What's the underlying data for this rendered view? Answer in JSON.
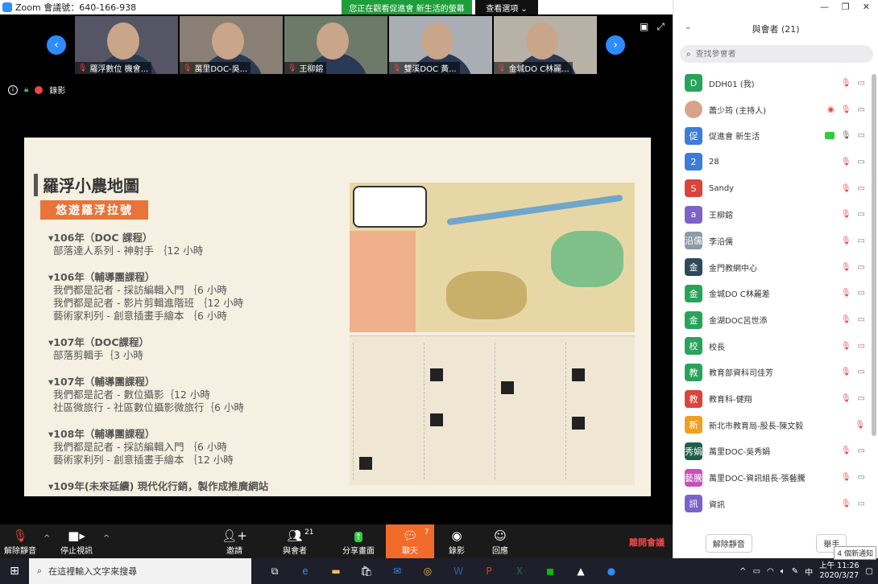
{
  "window": {
    "title": "Zoom 會議號：640-166-938",
    "banner": "您正在觀看促進會 新生活的螢幕",
    "view_options": "查看選項 ⌄"
  },
  "status": {
    "recording_label": "錄影"
  },
  "thumbnails": [
    {
      "name": "羅浮數位 機會..."
    },
    {
      "name": "萬里DOC-吳..."
    },
    {
      "name": "王柳鎔"
    },
    {
      "name": "雙溪DOC   黃..."
    },
    {
      "name": "金城DO C林麗..."
    }
  ],
  "slide": {
    "title": "羅浮小農地圖",
    "subtitle": "悠遊羅浮拉號",
    "groups": [
      {
        "heading": "▾106年（DOC 課程）",
        "items": [
          "部落達人系列 - 神射手 ｛12 小時"
        ]
      },
      {
        "heading": "▾106年（輔導團課程）",
        "items": [
          "我們都是記者 - 採訪編輯入門 ｛6 小時",
          "我們都是記者 - 影片剪輯進階班 ｛12 小時",
          "藝術家利列 - 創意插畫手繪本 ｛6 小時"
        ]
      },
      {
        "heading": "▾107年（DOC課程）",
        "items": [
          "部落剪輯手｛3 小時"
        ]
      },
      {
        "heading": "▾107年（輔導團課程）",
        "items": [
          "我們都是記者 - 數位攝影｛12 小時",
          "社區微旅行 - 社區數位攝影微旅行｛6 小時"
        ]
      },
      {
        "heading": "▾108年（輔導團課程）",
        "items": [
          "我們都是記者 - 採訪編輯入門 ｛6 小時",
          "藝術家利列 - 創意插畫手繪本 ｛12 小時"
        ]
      },
      {
        "heading": "▾109年(未來延續) 現代化行銷，製作成推廣網站",
        "items": []
      }
    ]
  },
  "toolbar": {
    "unmute": "解除靜音",
    "stop_video": "停止視訊",
    "invite": "邀請",
    "participants": "與會者",
    "participants_count": "21",
    "share": "分享畫面",
    "chat": "聊天",
    "chat_count": "7",
    "record": "錄影",
    "reactions": "回應",
    "leave": "離開會議"
  },
  "panel": {
    "header": "與會者 (21)",
    "search_placeholder": "查找參會者",
    "participants": [
      {
        "avatar": "D",
        "color": "#2aa35a",
        "name": "DDH01 (我)",
        "mic": "muted",
        "cam": "on"
      },
      {
        "avatar": "",
        "color": "#d9a28a",
        "name": "蕭少筠 (主持人)",
        "mic": "muted",
        "cam": "on",
        "recording": true
      },
      {
        "avatar": "促",
        "color": "#3b7dd8",
        "name": "促進會 新生活",
        "mic": "on",
        "cam": "on",
        "sharing": true
      },
      {
        "avatar": "2",
        "color": "#3b7dd8",
        "name": "28",
        "mic": "muted",
        "cam": "on"
      },
      {
        "avatar": "S",
        "color": "#d9443b",
        "name": "Sandy",
        "mic": "muted",
        "cam": "off"
      },
      {
        "avatar": "a",
        "color": "#7b63c9",
        "name": "王柳鎔",
        "mic": "muted",
        "cam": "on"
      },
      {
        "avatar": "沿儒",
        "color": "#8a9aa6",
        "name": "李沿儒",
        "mic": "muted",
        "cam": "on"
      },
      {
        "avatar": "金",
        "color": "#2e4a5a",
        "name": "金門教網中心",
        "mic": "muted",
        "cam": "on"
      },
      {
        "avatar": "金",
        "color": "#2aa35a",
        "name": "金城DO C林麗差",
        "mic": "muted",
        "cam": "on"
      },
      {
        "avatar": "金",
        "color": "#2aa35a",
        "name": "金湖DOC呂世添",
        "mic": "muted",
        "cam": "on"
      },
      {
        "avatar": "校",
        "color": "#2aa35a",
        "name": "校長",
        "mic": "muted",
        "cam": "off"
      },
      {
        "avatar": "教",
        "color": "#2aa35a",
        "name": "教育部資科司佳芳",
        "mic": "muted",
        "cam": "on"
      },
      {
        "avatar": "教",
        "color": "#d9443b",
        "name": "教育科-健翔",
        "mic": "muted",
        "cam": "on"
      },
      {
        "avatar": "新",
        "color": "#f0a020",
        "name": "新北市教育局-股長-陳文毅",
        "mic": "muted",
        "cam": "none"
      },
      {
        "avatar": "秀娟",
        "color": "#1f5f4a",
        "name": "萬里DOC-吳秀娟",
        "mic": "muted",
        "cam": "on"
      },
      {
        "avatar": "藝騰",
        "color": "#c94fb8",
        "name": "萬里DOC-資訊組長-張藝騰",
        "mic": "muted",
        "cam": "on"
      },
      {
        "avatar": "訊",
        "color": "#7b63c9",
        "name": "資訊",
        "mic": "muted",
        "cam": "on"
      }
    ],
    "footer_unmute": "解除靜音",
    "footer_raise_hand": "舉手"
  },
  "taskbar": {
    "search_placeholder": "在這裡輸入文字來搜尋",
    "time": "上午 11:26",
    "date": "2020/3/27",
    "ime": "中",
    "notification": "4 個新通知"
  }
}
